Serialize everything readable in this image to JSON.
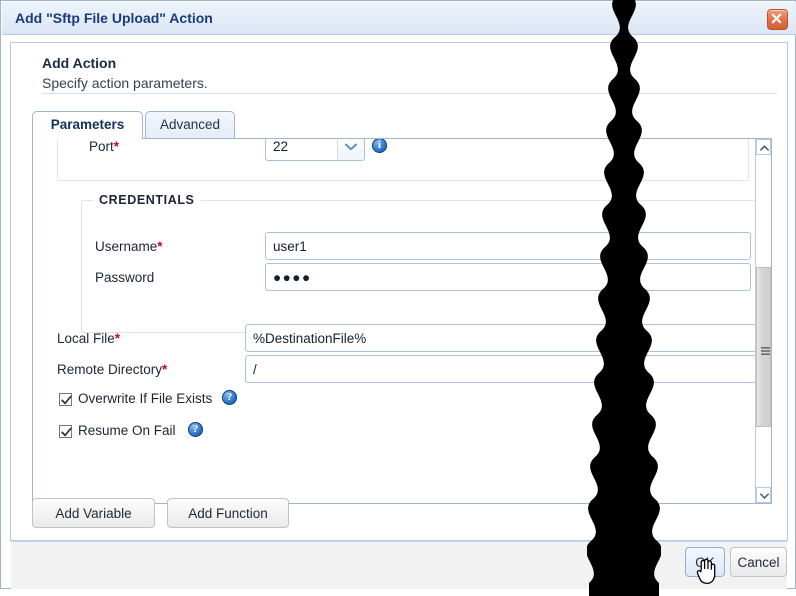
{
  "window": {
    "title": "Add \"Sftp File Upload\" Action",
    "close_icon": "close-icon"
  },
  "header": {
    "title": "Add Action",
    "subtitle": "Specify action parameters."
  },
  "tabs": [
    {
      "label": "Parameters",
      "active": true
    },
    {
      "label": "Advanced",
      "active": false
    }
  ],
  "form": {
    "port": {
      "label": "Port",
      "required": "*",
      "value": "22",
      "dropdown_icon": "chevron-down-icon",
      "info_icon": "info-icon"
    },
    "credentials": {
      "legend": "CREDENTIALS",
      "username": {
        "label": "Username",
        "required": "*",
        "value": "user1"
      },
      "password": {
        "label": "Password",
        "required": "",
        "value": "●●●●"
      }
    },
    "local_file": {
      "label": "Local File",
      "required": "*",
      "value": "%DestinationFile%"
    },
    "remote_directory": {
      "label": "Remote Directory",
      "required": "*",
      "value": "/"
    },
    "overwrite": {
      "label": "Overwrite If File Exists",
      "checked": true,
      "help_icon": "help-icon",
      "help_glyph": "?"
    },
    "resume": {
      "label": "Resume On Fail",
      "checked": true,
      "help_icon": "help-icon",
      "help_glyph": "?"
    }
  },
  "actions": {
    "add_variable": "Add Variable",
    "add_function": "Add Function"
  },
  "footer": {
    "ok": "OK",
    "cancel": "Cancel"
  },
  "colors": {
    "title_text": "#1b3c7a",
    "required_marker": "#d0021b",
    "close_button": "#e2734a",
    "tab_active_text": "#14305f",
    "info_icon": "#2f74c8",
    "panel_border": "#b9cce4"
  }
}
